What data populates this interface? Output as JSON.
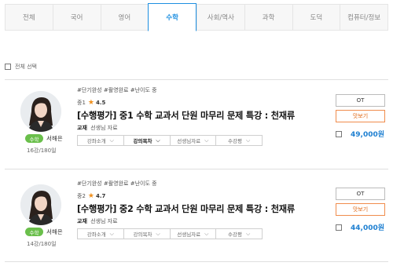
{
  "tabs": [
    {
      "label": "전체"
    },
    {
      "label": "국어"
    },
    {
      "label": "영어"
    },
    {
      "label": "수학"
    },
    {
      "label": "사회/역사"
    },
    {
      "label": "과학"
    },
    {
      "label": "도덕"
    },
    {
      "label": "컴퓨터/정보"
    }
  ],
  "active_tab": "수학",
  "select_all_label": "전체 선택",
  "courses": [
    {
      "tags": "#단기완성 #촬영완료 #난이도 중",
      "grade": "중1",
      "rating": "4.5",
      "title": "[수행평가] 중1 수학 교과서 단원 마무리 문제 특강 : 천재류",
      "material_label": "교재",
      "material_value": "선생님 자료",
      "subject_badge": "수학",
      "teacher": "서해은",
      "lectures": "16강/180일",
      "subtabs": [
        "강좌소개",
        "강의목차",
        "선생님자료",
        "수강평"
      ],
      "ot_label": "OT",
      "preview_label": "맛보기",
      "price": "49,000원"
    },
    {
      "tags": "#단기완성 #촬영완료 #난이도 중",
      "grade": "중2",
      "rating": "4.7",
      "title": "[수행평가] 중2 수학 교과서 단원 마무리 문제 특강 : 천재류",
      "material_label": "교재",
      "material_value": "선생님 자료",
      "subject_badge": "수학",
      "teacher": "서해은",
      "lectures": "14강/180일",
      "subtabs": [
        "강좌소개",
        "강의목차",
        "선생님자료",
        "수강평"
      ],
      "ot_label": "OT",
      "preview_label": "맛보기",
      "price": "44,000원"
    }
  ],
  "colors": {
    "accent": "#1d8fe1",
    "price": "#1d7fd1",
    "badge": "#6abf4b",
    "star": "#f0901d",
    "preview": "#e06b1a"
  },
  "icons": {
    "checkbox": "checkbox-icon",
    "star": "star-icon",
    "chevron": "chevron-down-icon"
  }
}
